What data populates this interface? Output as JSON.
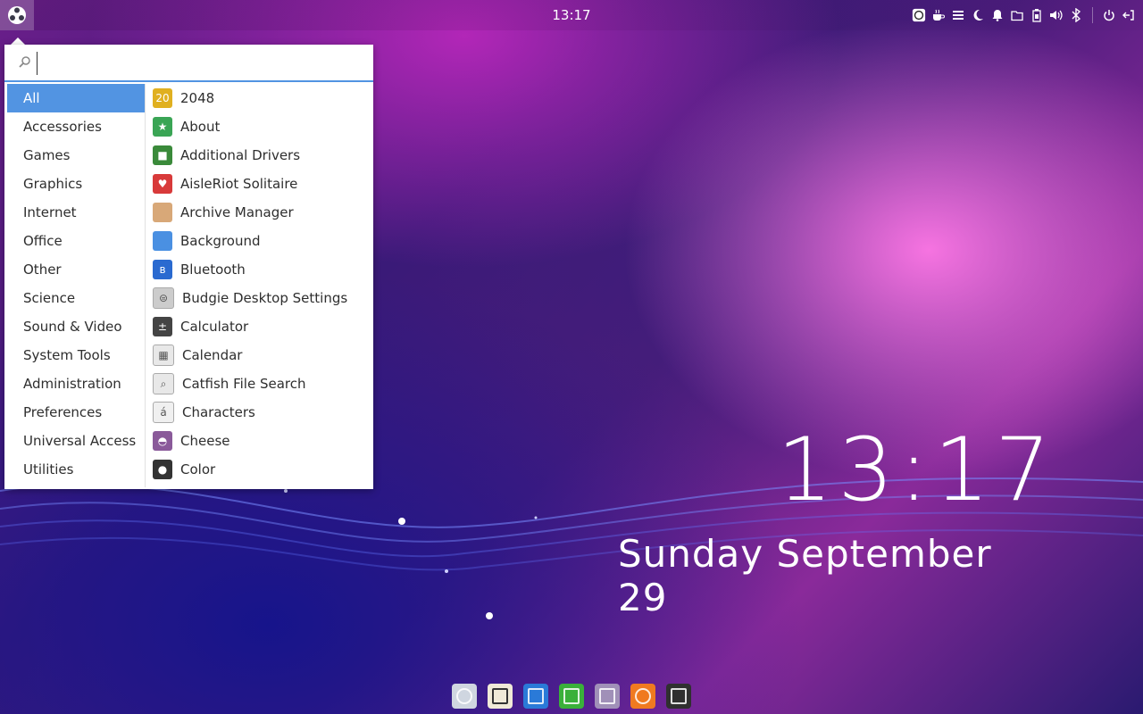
{
  "colors": {
    "accent": "#5294e2",
    "menu_bg": "#ffffff",
    "text": "#2e2e2e"
  },
  "top_panel": {
    "clock": "13:17",
    "menu_icon": "budgie-menu-icon",
    "tray_icons": [
      "caffeine-icon",
      "coffee-icon",
      "raven-menu-icon",
      "night-light-icon",
      "notifications-icon",
      "files-icon",
      "battery-icon",
      "volume-icon",
      "bluetooth-icon",
      "power-icon",
      "logout-icon"
    ]
  },
  "menu": {
    "search": {
      "value": "",
      "placeholder": ""
    },
    "categories": [
      {
        "label": "All"
      },
      {
        "label": "Accessories"
      },
      {
        "label": "Games"
      },
      {
        "label": "Graphics"
      },
      {
        "label": "Internet"
      },
      {
        "label": "Office"
      },
      {
        "label": "Other"
      },
      {
        "label": "Science"
      },
      {
        "label": "Sound & Video"
      },
      {
        "label": "System Tools"
      },
      {
        "label": "Administration"
      },
      {
        "label": "Preferences"
      },
      {
        "label": "Universal Access"
      },
      {
        "label": "Utilities"
      }
    ],
    "selected_category": "All",
    "apps": [
      {
        "label": "2048",
        "icon": "2048-icon",
        "color": "#e0b020",
        "glyph": "20"
      },
      {
        "label": "About",
        "icon": "about-star-icon",
        "color": "#3aa555",
        "glyph": "★"
      },
      {
        "label": "Additional Drivers",
        "icon": "chip-icon",
        "color": "#3a8a3a",
        "glyph": "■"
      },
      {
        "label": "AisleRiot Solitaire",
        "icon": "heart-card-icon",
        "color": "#d83a3a",
        "glyph": "♥"
      },
      {
        "label": "Archive Manager",
        "icon": "archive-box-icon",
        "color": "#d8a878",
        "glyph": ""
      },
      {
        "label": "Background",
        "icon": "background-icon",
        "color": "#4a90e2",
        "glyph": ""
      },
      {
        "label": "Bluetooth",
        "icon": "bluetooth-icon",
        "color": "#2a6ad0",
        "glyph": "ʙ"
      },
      {
        "label": "Budgie Desktop Settings",
        "icon": "settings-toggle-icon",
        "color": "#cccccc",
        "glyph": "⊜"
      },
      {
        "label": "Calculator",
        "icon": "calculator-icon",
        "color": "#444444",
        "glyph": "±"
      },
      {
        "label": "Calendar",
        "icon": "calendar-icon",
        "color": "#e8e8e8",
        "glyph": "▦"
      },
      {
        "label": "Catfish File Search",
        "icon": "magnifier-icon",
        "color": "#e8e8e8",
        "glyph": "⌕"
      },
      {
        "label": "Characters",
        "icon": "characters-icon",
        "color": "#f0f0f0",
        "glyph": "á"
      },
      {
        "label": "Cheese",
        "icon": "cheese-icon",
        "color": "#8a5a9a",
        "glyph": "◓"
      },
      {
        "label": "Color",
        "icon": "color-wheel-icon",
        "color": "#333333",
        "glyph": "●"
      }
    ]
  },
  "desktop_clock": {
    "time": "13:17",
    "date": "Sunday September 29"
  },
  "dock": [
    {
      "name": "dock-web-browser",
      "icon": "globe-grid-icon",
      "color": "#cfd6e0"
    },
    {
      "name": "dock-music",
      "icon": "music-note-icon",
      "color": "#f0ead8"
    },
    {
      "name": "dock-writer",
      "icon": "document-icon",
      "color": "#2a7ad8"
    },
    {
      "name": "dock-spreadsheet",
      "icon": "spreadsheet-icon",
      "color": "#3ab03a"
    },
    {
      "name": "dock-files",
      "icon": "folder-icon",
      "color": "#a090b8"
    },
    {
      "name": "dock-firefox",
      "icon": "firefox-icon",
      "color": "#f07a20"
    },
    {
      "name": "dock-terminal",
      "icon": "terminal-icon",
      "color": "#303030"
    }
  ]
}
